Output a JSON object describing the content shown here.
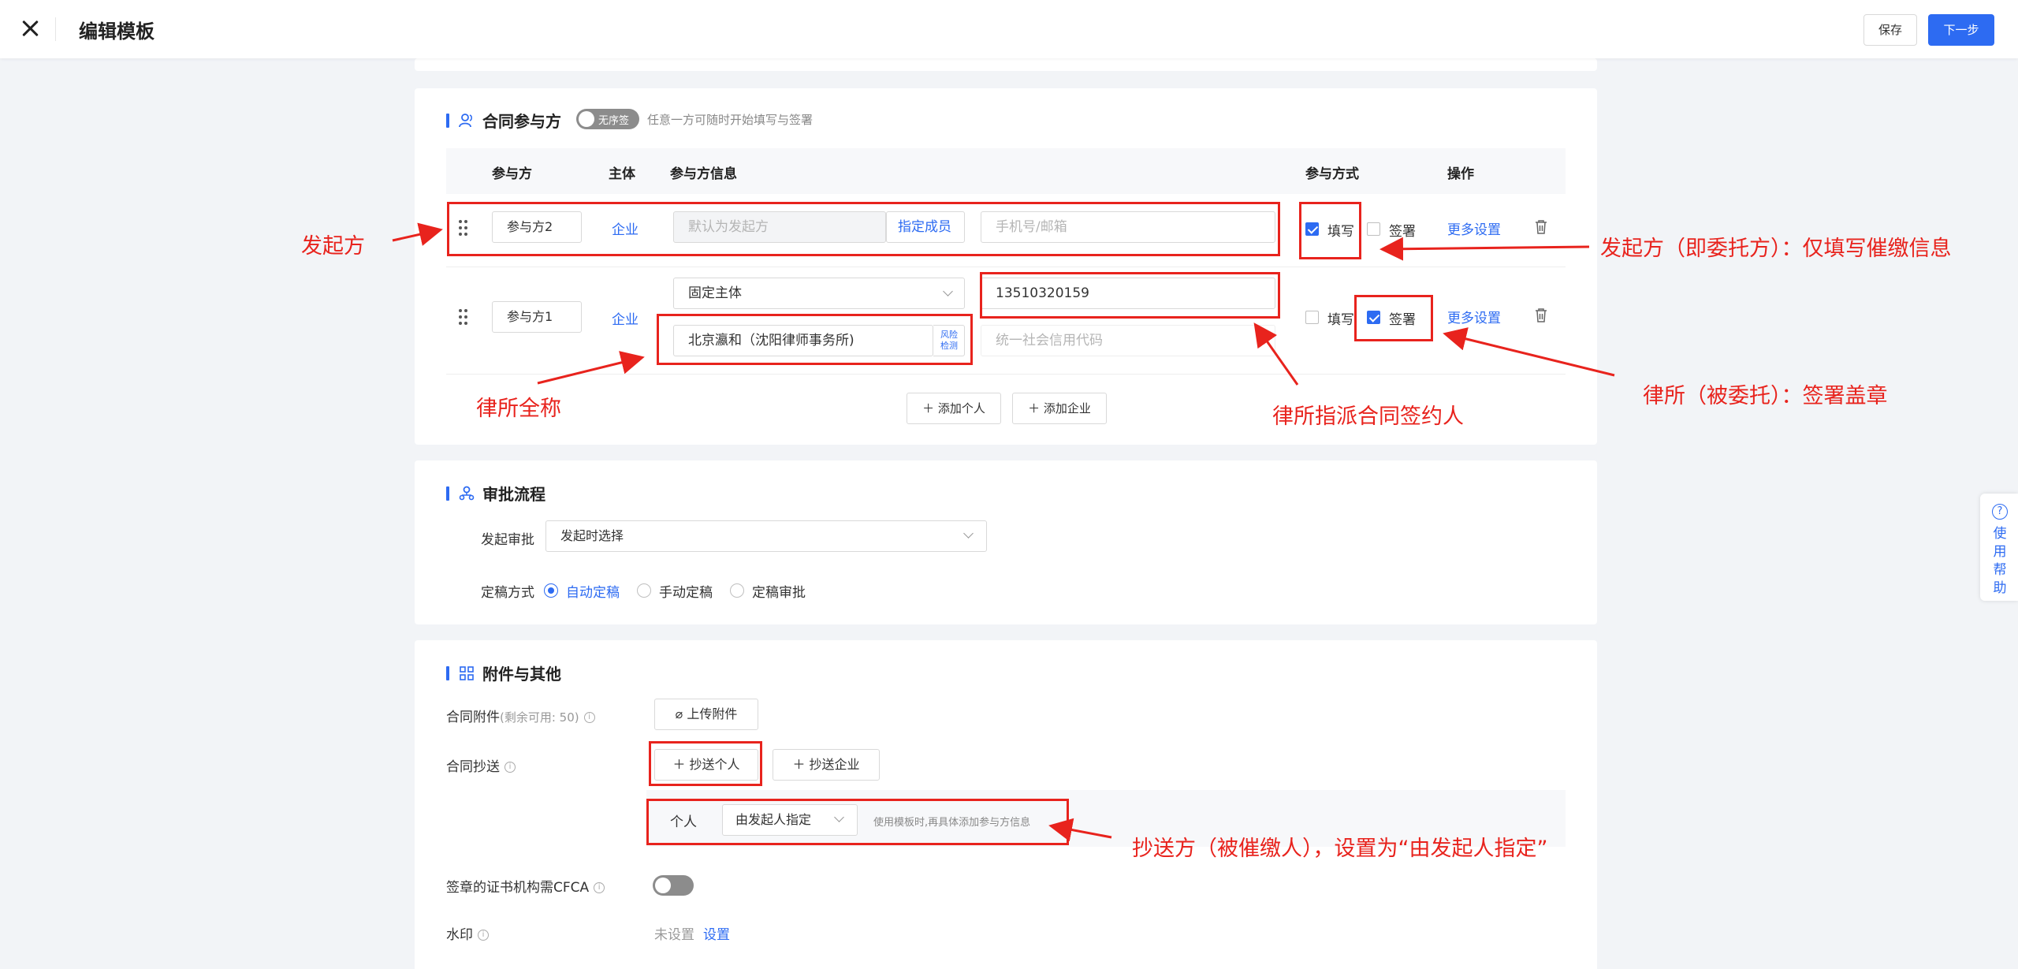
{
  "header": {
    "title": "编辑模板",
    "save": "保存",
    "next": "下一步"
  },
  "participants": {
    "title": "合同参与方",
    "toggle_label": "无序签",
    "toggle_desc": "任意一方可随时开始填写与签署",
    "columns": [
      "参与方",
      "主体",
      "参与方信息",
      "参与方式",
      "操作"
    ],
    "row1": {
      "name": "参与方2",
      "subject": "企业",
      "info_placeholder": "默认为发起方",
      "assign_member": "指定成员",
      "contact_placeholder": "手机号/邮箱",
      "fill": "填写",
      "sign": "签署",
      "more": "更多设置"
    },
    "row2": {
      "name": "参与方1",
      "subject": "企业",
      "entity_type": "固定主体",
      "phone": "13510320159",
      "company": "北京瀛和（沈阳律师事务所)",
      "risk_line1": "风险",
      "risk_line2": "检测",
      "credit_placeholder": "统一社会信用代码",
      "fill": "填写",
      "sign": "签署",
      "more": "更多设置"
    },
    "add_person": "添加个人",
    "add_company": "添加企业"
  },
  "approval": {
    "title": "审批流程",
    "initiate_label": "发起审批",
    "initiate_value": "发起时选择",
    "finalize_label": "定稿方式",
    "options": [
      "自动定稿",
      "手动定稿",
      "定稿审批"
    ]
  },
  "attachments": {
    "title": "附件与其他",
    "attach_label": "合同附件",
    "attach_remaining": "(剩余可用: 50)",
    "upload": "上传附件",
    "cc_label": "合同抄送",
    "cc_person": "抄送个人",
    "cc_company": "抄送企业",
    "cc_row_type": "个人",
    "cc_row_select": "由发起人指定",
    "cc_row_hint": "使用模板时,再具体添加参与方信息",
    "cfca_label": "签章的证书机构需CFCA",
    "watermark_label": "水印",
    "watermark_status": "未设置",
    "watermark_set": "设置"
  },
  "help": {
    "text": "使用帮助"
  },
  "annotations": {
    "initiator": "发起方",
    "initiator_note": "发起方（即委托方）：仅填写催缴信息",
    "law_firm_name": "律所全称",
    "signer": "律所指派合同签约人",
    "law_firm_note": "律所（被委托）：签署盖章",
    "cc_note": "抄送方（被催缴人），设置为“由发起人指定”"
  },
  "colors": {
    "primary": "#2d6bf2",
    "annotation": "#e8231d"
  }
}
